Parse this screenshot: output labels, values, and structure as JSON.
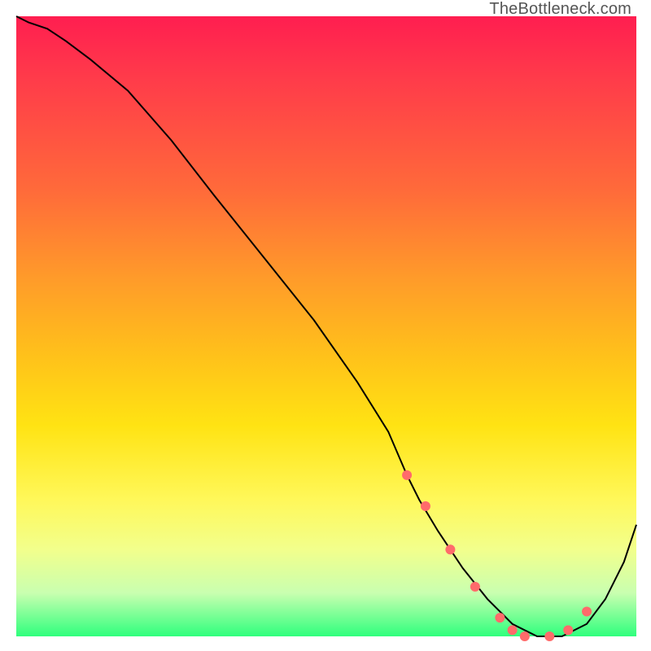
{
  "watermark": "TheBottleneck.com",
  "chart_data": {
    "type": "line",
    "title": "",
    "xlabel": "",
    "ylabel": "",
    "xlim": [
      0,
      100
    ],
    "ylim": [
      0,
      100
    ],
    "grid": false,
    "series": [
      {
        "name": "curve",
        "color": "#000000",
        "x": [
          0,
          2,
          5,
          8,
          12,
          18,
          25,
          32,
          40,
          48,
          55,
          60,
          63,
          65,
          68,
          72,
          76,
          80,
          84,
          88,
          92,
          95,
          98,
          100
        ],
        "y": [
          100,
          99,
          98,
          96,
          93,
          88,
          80,
          71,
          61,
          51,
          41,
          33,
          26,
          22,
          17,
          11,
          6,
          2,
          0,
          0,
          2,
          6,
          12,
          18
        ]
      }
    ],
    "markers": {
      "name": "highlight-dots",
      "color": "#ff6b6b",
      "radius": 6,
      "x": [
        63,
        66,
        70,
        74,
        78,
        80,
        82,
        86,
        89,
        92
      ],
      "y": [
        26,
        21,
        14,
        8,
        3,
        1,
        0,
        0,
        1,
        4
      ]
    },
    "background_gradient": {
      "stops": [
        {
          "pos": 0.0,
          "color": "#ff1e50"
        },
        {
          "pos": 0.28,
          "color": "#ff6a3a"
        },
        {
          "pos": 0.55,
          "color": "#ffc21a"
        },
        {
          "pos": 0.78,
          "color": "#fff85a"
        },
        {
          "pos": 1.0,
          "color": "#2fff7d"
        }
      ]
    }
  }
}
